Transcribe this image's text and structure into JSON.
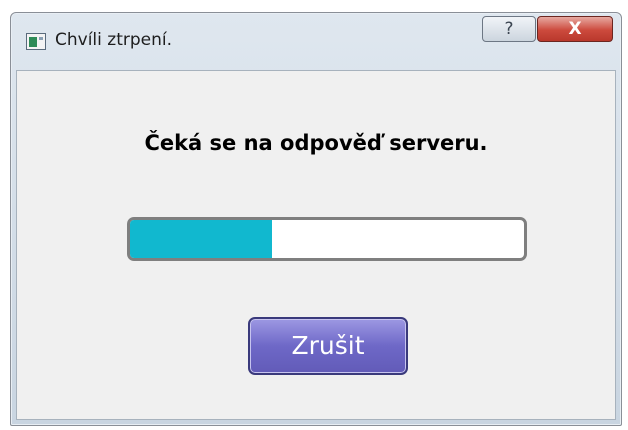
{
  "window": {
    "title": "Chvíli ztrpení.",
    "help_label": "?",
    "close_label": "X"
  },
  "dialog": {
    "message": "Čeká se na odpověď serveru.",
    "progress": 0.36,
    "cancel_label": "Zrušit"
  },
  "colors": {
    "progress_fill": "#11b8cf",
    "button_fill": "#6e68c7"
  },
  "icons": {
    "app_icon": "window-app-icon",
    "help_icon": "question-mark-icon",
    "close_icon": "close-icon"
  }
}
